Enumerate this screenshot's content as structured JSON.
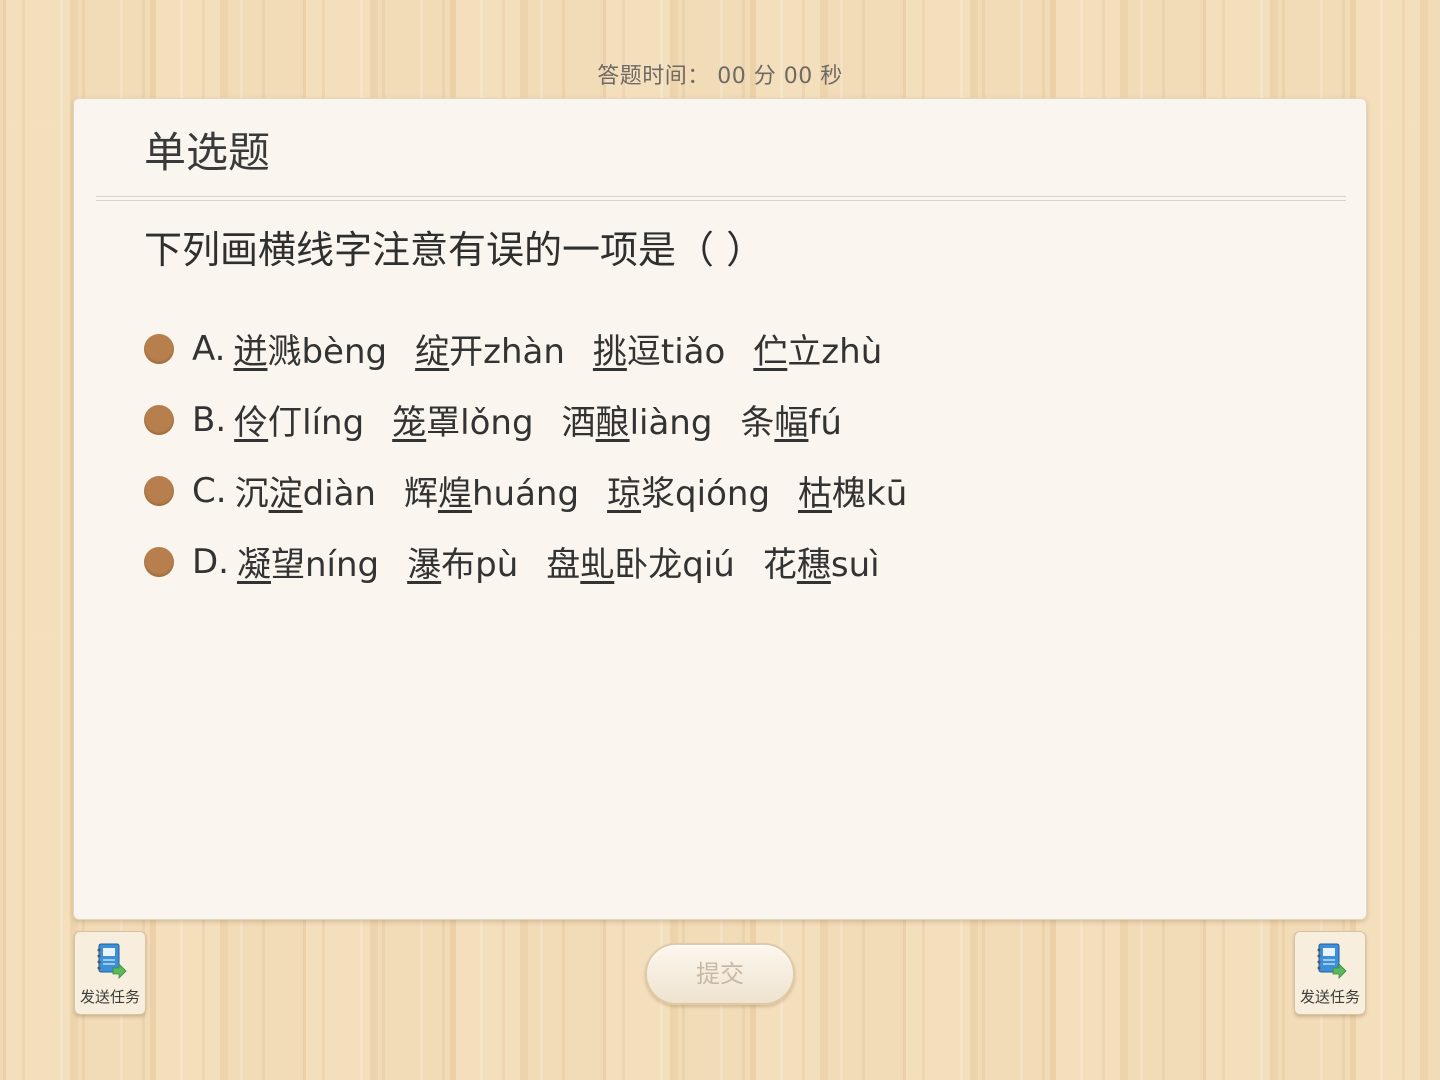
{
  "timer": {
    "label": "答题时间：",
    "minutes": "00",
    "minutes_unit": "分",
    "seconds": "00",
    "seconds_unit": "秒"
  },
  "card": {
    "title": "单选题",
    "question": "下列画横线字注意有误的一项是（    ）"
  },
  "options": [
    {
      "letter": "A.",
      "words": [
        {
          "pre": "",
          "u": "迸",
          "post": "溅bèng"
        },
        {
          "pre": "",
          "u": "绽",
          "post": "开zhàn"
        },
        {
          "pre": "",
          "u": "挑",
          "post": "逗tiǎo"
        },
        {
          "pre": "",
          "u": "伫",
          "post": "立zhù"
        }
      ]
    },
    {
      "letter": "B.",
      "words": [
        {
          "pre": "",
          "u": "伶",
          "post": "仃líng"
        },
        {
          "pre": "",
          "u": "笼",
          "post": "罩lǒng"
        },
        {
          "pre": "酒",
          "u": "酿",
          "post": "liàng"
        },
        {
          "pre": "条",
          "u": "幅",
          "post": "fú"
        }
      ]
    },
    {
      "letter": "C.",
      "words": [
        {
          "pre": "沉",
          "u": "淀",
          "post": "diàn"
        },
        {
          "pre": "辉",
          "u": "煌",
          "post": "huáng"
        },
        {
          "pre": "",
          "u": "琼",
          "post": "浆qióng"
        },
        {
          "pre": "",
          "u": "枯",
          "post": "槐kū"
        }
      ]
    },
    {
      "letter": "D.",
      "words": [
        {
          "pre": "",
          "u": "凝",
          "post": "望níng"
        },
        {
          "pre": "",
          "u": "瀑",
          "post": "布pù"
        },
        {
          "pre": "盘",
          "u": "虬",
          "post": "卧龙qiú"
        },
        {
          "pre": "花",
          "u": "穗",
          "post": "suì"
        }
      ]
    }
  ],
  "buttons": {
    "send_task_left": "发送任务",
    "send_task_right": "发送任务",
    "submit": "提交"
  },
  "icons": {
    "send_task": "notebook-send-icon"
  },
  "colors": {
    "radio": "#b77f4d",
    "card_bg": "#faf6ef",
    "submit_text": "#c7b9a5"
  }
}
